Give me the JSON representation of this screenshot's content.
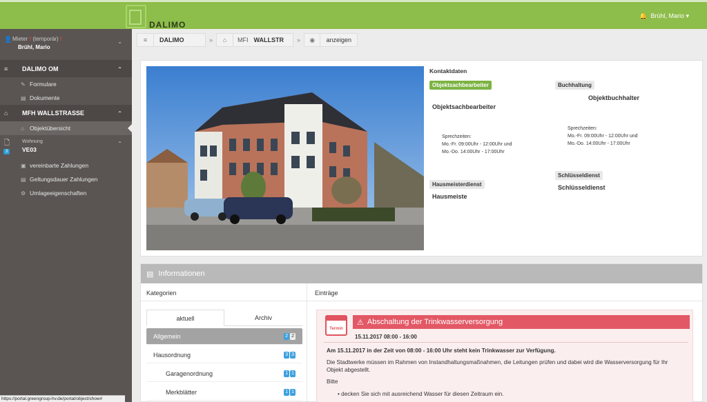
{
  "app": {
    "logo_text": "DALIMO",
    "user": "Brühl, Mario ▾"
  },
  "sidebar": {
    "user_role": "Mieter",
    "temporary": "(temporär)",
    "user_name": "Brühl, Mario",
    "section_om": "DALIMO OM",
    "item_formulare": "Formulare",
    "item_dokumente": "Dokumente",
    "section_mfh": "MFH WALLSTRASSE",
    "item_objekt": "Objektübersicht",
    "wohnung_label": "Wohnung",
    "wohnung_badge": "3",
    "wohnung_name": "VE03",
    "item_zahlungen": "vereinbarte Zahlungen",
    "item_dauer": "Geltungsdauer Zahlungen",
    "item_umlage": "Umlageeigenschaften",
    "status_url": "https://portal.greengroup-hv.de/portal/object/show#"
  },
  "breadcrumb": {
    "b1": "DALIMO",
    "b2_prefix": "MFI",
    "b2": "WALLSTR",
    "b3": "anzeigen"
  },
  "contacts": {
    "title": "Kontaktdaten",
    "obj_tag": "Objektsachbearbeiter",
    "obj_name": "Objektsachbearbeiter",
    "obj_hours": [
      "Sprechzeiten:",
      "Mo.-Fr. 09:00Uhr - 12:00Uhr und",
      "Mo.-Do. 14:00Uhr - 17:00Uhr"
    ],
    "buch_tag": "Buchhaltung",
    "buch_name": "Objektbuchhalter",
    "buch_hours": [
      "Sprechzeiten:",
      "Mo.-Fr. 09:00Uhr - 12:00Uhr und",
      "Mo.-Do. 14:00Uhr - 17:00Uhr"
    ],
    "haus_tag": "Hausmeisterdienst",
    "haus_name": "Hausmeiste",
    "schl_tag": "Schlüsseldienst",
    "schl_name": "Schlüsseldienst"
  },
  "info": {
    "title": "Informationen",
    "col_kategorien": "Kategorien",
    "col_eintraege": "Einträge",
    "tab_aktuell": "aktuell",
    "tab_archiv": "Archiv",
    "categories": [
      {
        "label": "Allgemein",
        "a": "2",
        "b": "2"
      },
      {
        "label": "Hausordnung",
        "a": "3",
        "b": "3"
      },
      {
        "label": "Garagenordnung",
        "a": "1",
        "b": "1"
      },
      {
        "label": "Merkblätter",
        "a": "1",
        "b": "1"
      }
    ],
    "entry": {
      "icon_text": "Termin",
      "title": "Abschaltung der Trinkwasserversorgung",
      "date": "15.11.2017 08:00 - 16:00",
      "p1": "Am 15.11.2017 in der Zeit von 08:00 - 16:00 Uhr steht kein Trinkwasser zur Verfügung.",
      "p2": "Die Stadtwerke müssen im Rahmen von Instandhaltungsmaßnahmen, die Leitungen prüfen und dabei wird die Wasserversorgung für Ihr Objekt abgestellt.",
      "p3": "Bitte",
      "p4": "• decken Sie sich mit ausreichend Wasser für diesen Zeitraum ein."
    }
  }
}
